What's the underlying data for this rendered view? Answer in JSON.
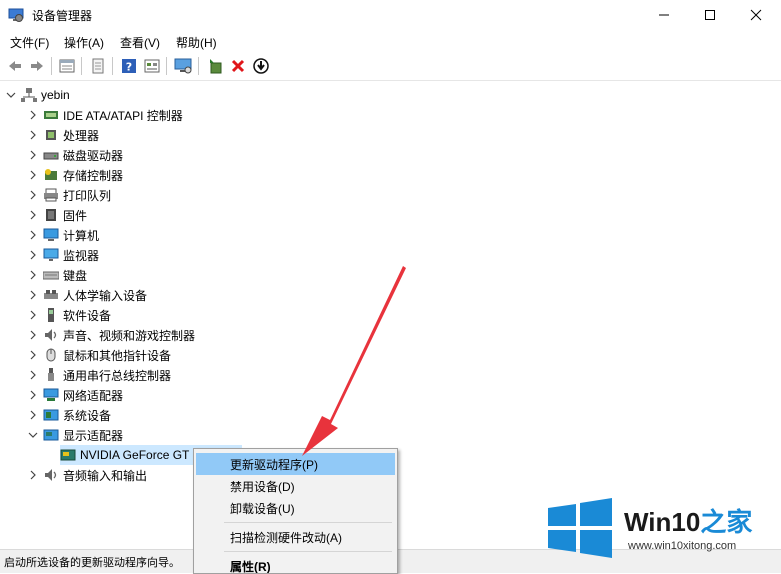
{
  "window": {
    "title": "设备管理器",
    "colors": {
      "selection": "#cce8ff",
      "menu_highlight": "#91c9f7",
      "arrow": "#e8333c",
      "logo_blue": "#1a8ad6"
    }
  },
  "menu": [
    "文件(F)",
    "操作(A)",
    "查看(V)",
    "帮助(H)"
  ],
  "toolbar": {
    "icons": [
      "back-icon",
      "forward-icon",
      "properties-icon",
      "update-icon",
      "help-icon",
      "view-icon",
      "monitor-icon",
      "enable-device-icon",
      "uninstall-icon",
      "download-icon"
    ]
  },
  "tree": {
    "root": "yebin",
    "categories": [
      {
        "label": "IDE ATA/ATAPI 控制器",
        "icon": "ide-controller-icon"
      },
      {
        "label": "处理器",
        "icon": "processor-icon"
      },
      {
        "label": "磁盘驱动器",
        "icon": "disk-drive-icon"
      },
      {
        "label": "存储控制器",
        "icon": "storage-controller-icon"
      },
      {
        "label": "打印队列",
        "icon": "printer-icon"
      },
      {
        "label": "固件",
        "icon": "firmware-icon"
      },
      {
        "label": "计算机",
        "icon": "computer-icon"
      },
      {
        "label": "监视器",
        "icon": "monitor-icon"
      },
      {
        "label": "键盘",
        "icon": "keyboard-icon"
      },
      {
        "label": "人体学输入设备",
        "icon": "hid-icon"
      },
      {
        "label": "软件设备",
        "icon": "software-device-icon"
      },
      {
        "label": "声音、视频和游戏控制器",
        "icon": "sound-icon"
      },
      {
        "label": "鼠标和其他指针设备",
        "icon": "mouse-icon"
      },
      {
        "label": "通用串行总线控制器",
        "icon": "usb-icon"
      },
      {
        "label": "网络适配器",
        "icon": "network-adapter-icon"
      },
      {
        "label": "系统设备",
        "icon": "system-device-icon"
      },
      {
        "label": "显示适配器",
        "icon": "display-adapter-icon",
        "expanded": true
      }
    ],
    "child_device": "NVIDIA GeForce GT",
    "last_category": "音频输入和输出"
  },
  "context_menu": {
    "items": [
      "更新驱动程序(P)",
      "禁用设备(D)",
      "卸载设备(U)",
      "扫描检测硬件改动(A)",
      "属性(R)"
    ]
  },
  "status_bar": "启动所选设备的更新驱动程序向导。",
  "watermark": {
    "brand": "Win10",
    "brand_zh": "之家",
    "url": "www.win10xitong.com"
  }
}
